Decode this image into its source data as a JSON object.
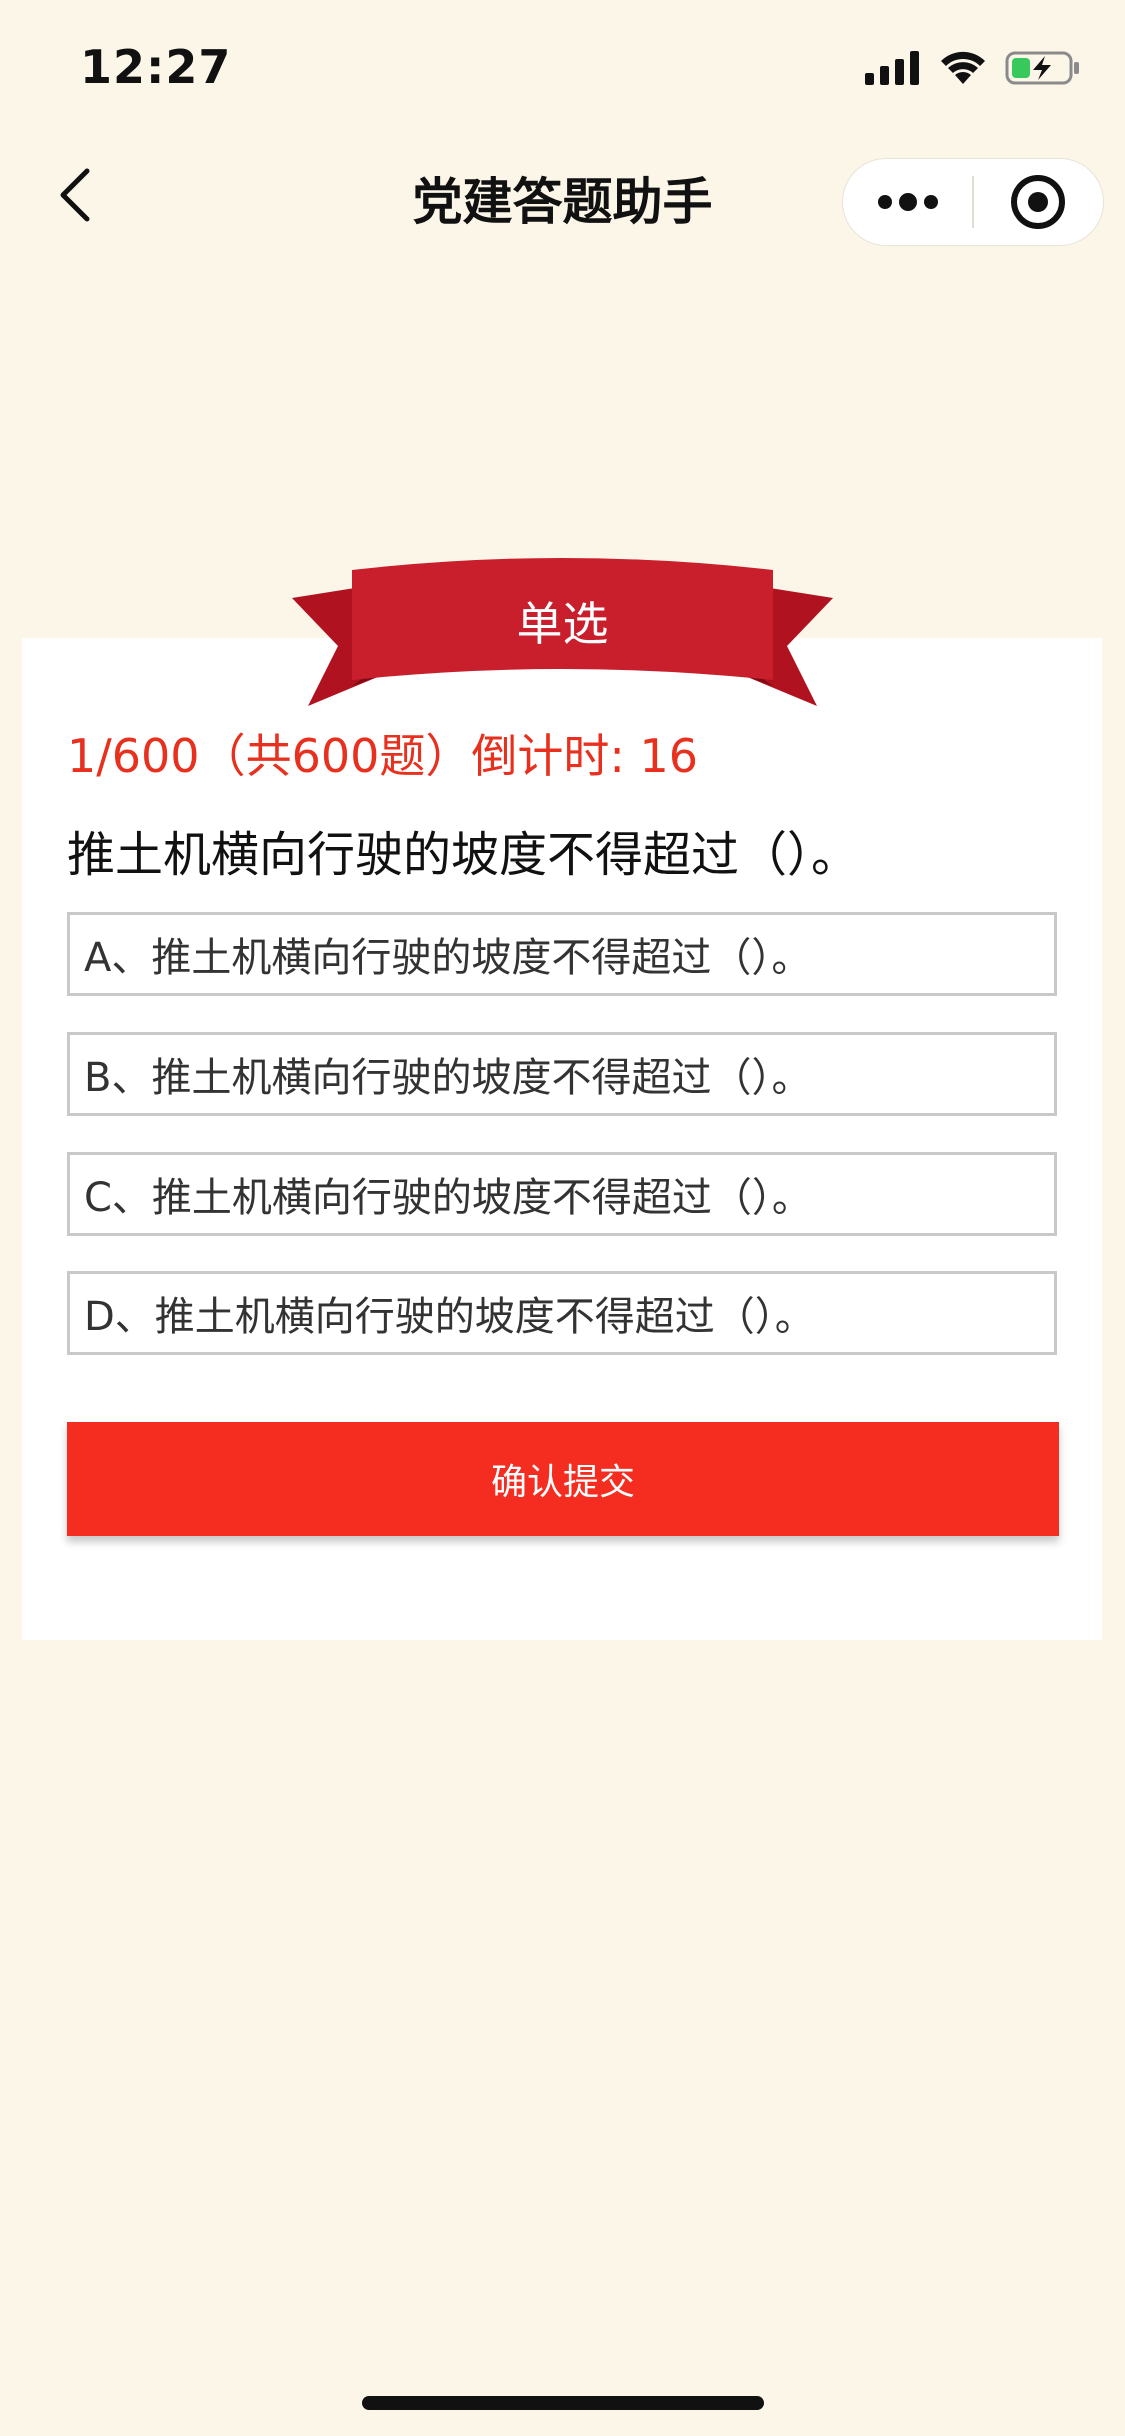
{
  "status_bar": {
    "time": "12:27",
    "icons": [
      "signal-icon",
      "wifi-icon",
      "battery-charging-icon"
    ]
  },
  "nav": {
    "title": "党建答题助手",
    "icons": [
      "back-chevron-icon",
      "more-dots-icon",
      "target-close-icon"
    ]
  },
  "quiz": {
    "type_label": "单选",
    "progress": "1/600（共600题）倒计时: 16",
    "question": "推土机横向行驶的坡度不得超过（）。",
    "options": [
      "A、推土机横向行驶的坡度不得超过（）。",
      "B、推土机横向行驶的坡度不得超过（）。",
      "C、推土机横向行驶的坡度不得超过（）。",
      "D、推土机横向行驶的坡度不得超过（）。"
    ],
    "submit_label": "确认提交"
  },
  "colors": {
    "background": "#fcf6e9",
    "accent_red": "#f52c20",
    "progress_red": "#e8301e",
    "ribbon_red": "#c91f2c",
    "ribbon_dark": "#a6101c"
  }
}
